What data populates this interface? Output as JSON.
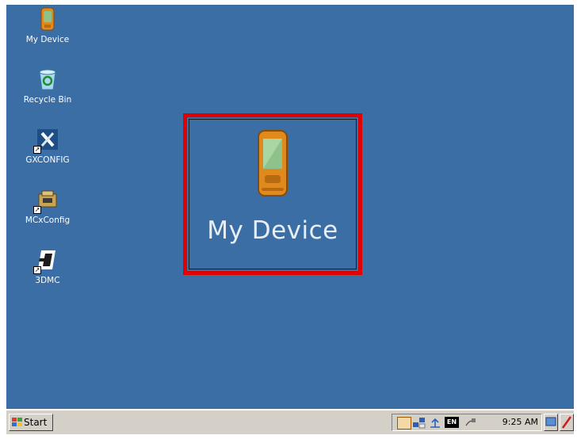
{
  "desktop": {
    "icons": [
      {
        "label": "My Device",
        "icon": "pda-device-icon"
      },
      {
        "label": "Recycle Bin",
        "icon": "recycle-bin-icon"
      },
      {
        "label": "GXCONFIG",
        "icon": "tools-icon"
      },
      {
        "label": "MCxConfig",
        "icon": "config-device-icon"
      },
      {
        "label": "3DMC",
        "icon": "3dmc-icon"
      }
    ],
    "highlight": {
      "label": "My Device",
      "icon": "pda-device-icon"
    }
  },
  "taskbar": {
    "start_label": "Start",
    "tray": {
      "lang_badge": "EN",
      "clock": "9:25 AM"
    }
  },
  "colors": {
    "desktop": "#3A6EA5",
    "taskbar": "#D4D0C8",
    "highlight_border": "#E00000"
  }
}
